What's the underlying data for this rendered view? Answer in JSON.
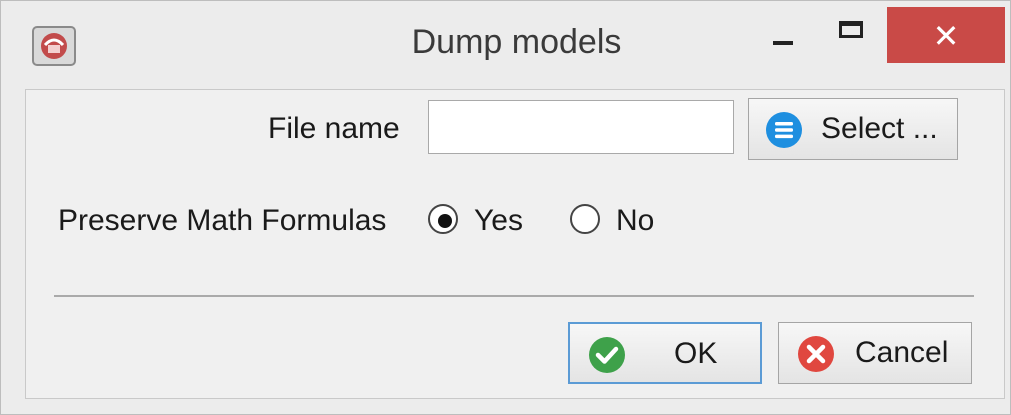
{
  "window": {
    "title": "Dump models",
    "close_glyph": "✕",
    "icons": {
      "app": "app-icon",
      "minimize": "minimize-icon",
      "maximize": "maximize-icon",
      "close": "close-icon"
    }
  },
  "form": {
    "file_name_label": "File name",
    "file_name_value": "",
    "select_button_label": "Select ...",
    "preserve_label": "Preserve Math Formulas",
    "options": [
      {
        "label": "Yes",
        "selected": true
      },
      {
        "label": "No",
        "selected": false
      }
    ]
  },
  "actions": {
    "ok_label": "OK",
    "cancel_label": "Cancel"
  },
  "colors": {
    "close_button": "#c94a47",
    "ok_focus_border": "#5b9bd5",
    "select_icon": "#1e8fe0",
    "ok_icon": "#3ea14a",
    "cancel_icon": "#e0473f"
  }
}
